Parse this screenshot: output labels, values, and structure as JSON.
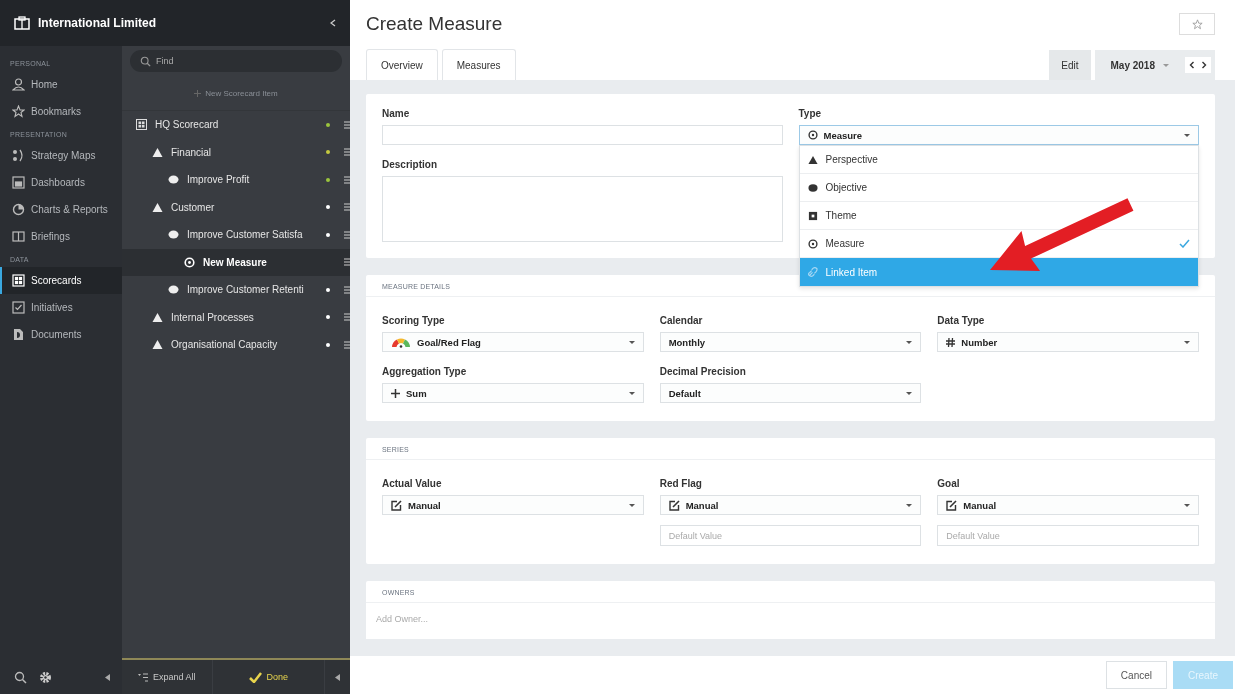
{
  "header": {
    "title": "International Limited"
  },
  "nav": {
    "sections": [
      {
        "heading": "PERSONAL",
        "items": [
          {
            "label": "Home",
            "kind": "person",
            "selected": false
          },
          {
            "label": "Bookmarks",
            "kind": "star",
            "selected": false
          }
        ]
      },
      {
        "heading": "PRESENTATION",
        "items": [
          {
            "label": "Strategy Maps",
            "kind": "map",
            "selected": false
          },
          {
            "label": "Dashboards",
            "kind": "dashboard",
            "selected": false
          },
          {
            "label": "Charts & Reports",
            "kind": "pie",
            "selected": false
          },
          {
            "label": "Briefings",
            "kind": "book",
            "selected": false
          }
        ]
      },
      {
        "heading": "DATA",
        "items": [
          {
            "label": "Scorecards",
            "kind": "scorecard",
            "selected": true
          },
          {
            "label": "Initiatives",
            "kind": "check",
            "selected": false
          },
          {
            "label": "Documents",
            "kind": "doc",
            "selected": false
          }
        ]
      }
    ]
  },
  "tree": {
    "search": {
      "placeholder": "Find"
    },
    "new_item": "New Scorecard Item",
    "items": [
      {
        "label": "HQ Scorecard",
        "kind": "scorecard",
        "color": "#9bc53d",
        "selected": false,
        "children": [
          {
            "label": "Financial",
            "kind": "perspective",
            "color": "#c4c93f",
            "selected": false,
            "children": [
              {
                "label": "Improve Profit",
                "kind": "objective",
                "color": "#9bc53d",
                "selected": false
              }
            ]
          },
          {
            "label": "Customer",
            "kind": "perspective",
            "color": "#ffffff",
            "selected": false,
            "children": [
              {
                "label": "Improve Customer Satisfa",
                "kind": "objective",
                "color": "#ffffff",
                "selected": false,
                "children": [
                  {
                    "label": "New Measure",
                    "kind": "measure",
                    "selected": true
                  }
                ]
              },
              {
                "label": "Improve Customer Retenti",
                "kind": "objective",
                "color": "#ffffff",
                "selected": false
              }
            ]
          },
          {
            "label": "Internal Processes",
            "kind": "perspective",
            "color": "#ffffff",
            "selected": false
          },
          {
            "label": "Organisational Capacity",
            "kind": "perspective",
            "color": "#ffffff",
            "selected": false
          }
        ]
      }
    ],
    "expand_all": "Expand All",
    "done": "Done"
  },
  "page": {
    "title": "Create Measure",
    "tabs": [
      {
        "label": "Overview",
        "selected": false
      },
      {
        "label": "Measures",
        "selected": false
      }
    ],
    "edit": "Edit",
    "period": "May 2018",
    "name": {
      "label": "Name"
    },
    "description": {
      "label": "Description"
    },
    "type": {
      "label": "Type",
      "value": "Measure",
      "options": [
        {
          "label": "Perspective",
          "kind": "perspective",
          "checked": false,
          "highlighted": false
        },
        {
          "label": "Objective",
          "kind": "objective",
          "checked": false,
          "highlighted": false
        },
        {
          "label": "Theme",
          "kind": "theme",
          "checked": false,
          "highlighted": false
        },
        {
          "label": "Measure",
          "kind": "measure",
          "checked": true,
          "highlighted": false
        },
        {
          "label": "Linked Item",
          "kind": "link",
          "checked": false,
          "highlighted": true
        }
      ]
    },
    "details": {
      "heading": "MEASURE DETAILS",
      "fields": [
        {
          "label": "Scoring Type",
          "value": "Goal/Red Flag",
          "kind": "gauge"
        },
        {
          "label": "Calendar",
          "value": "Monthly",
          "kind": "plain"
        },
        {
          "label": "Data Type",
          "value": "Number",
          "kind": "hash"
        },
        {
          "label": "Aggregation Type",
          "value": "Sum",
          "kind": "plus"
        },
        {
          "label": "Decimal Precision",
          "value": "Default",
          "kind": "plain"
        }
      ]
    },
    "series": {
      "heading": "SERIES",
      "fields": [
        {
          "label": "Actual Value",
          "value": "Manual",
          "kind": "edit"
        },
        {
          "label": "Red Flag",
          "value": "Manual",
          "kind": "edit",
          "placeholder": "Default Value"
        },
        {
          "label": "Goal",
          "value": "Manual",
          "kind": "edit",
          "placeholder": "Default Value"
        }
      ]
    },
    "owners": {
      "heading": "OWNERS",
      "placeholder": "Add Owner..."
    },
    "cancel": "Cancel",
    "create": {
      "label": "Create",
      "disabled": true
    }
  }
}
